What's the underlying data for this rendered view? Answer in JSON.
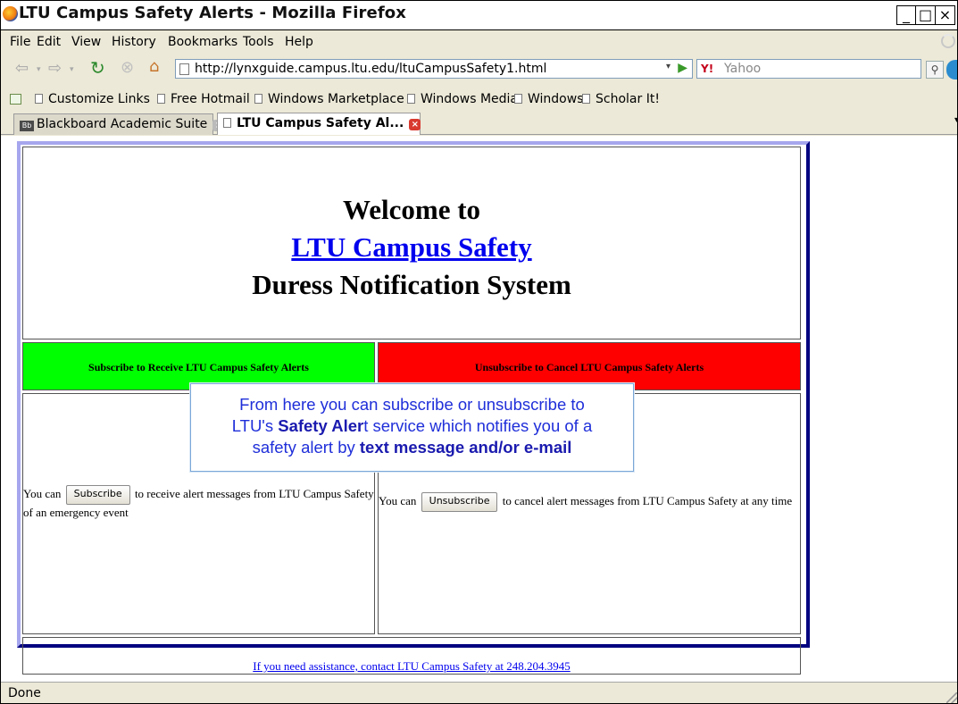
{
  "window": {
    "title": "LTU Campus Safety Alerts - Mozilla Firefox",
    "minimize_label": "_",
    "maximize_label": "□",
    "close_label": "×"
  },
  "menu": {
    "items": [
      "File",
      "Edit",
      "View",
      "History",
      "Bookmarks",
      "Tools",
      "Help"
    ]
  },
  "nav": {
    "url": "http://lynxguide.campus.ltu.edu/ltuCampusSafety1.html",
    "search_placeholder": "Yahoo",
    "search_engine": "Y!"
  },
  "bookmarks": {
    "items": [
      "Customize Links",
      "Free Hotmail",
      "Windows Marketplace",
      "Windows Media",
      "Windows",
      "Scholar It!"
    ]
  },
  "tabs": [
    {
      "label": "Blackboard Academic Suite",
      "icon": "Bb",
      "active": false
    },
    {
      "label": "LTU Campus Safety Al...",
      "active": true
    }
  ],
  "page": {
    "welcome": "Welcome to",
    "campus_link": "LTU Campus Safety",
    "system_name": "Duress Notification System",
    "subscribe_header": "Subscribe to Receive LTU Campus Safety Alerts",
    "unsubscribe_header": "Unsubscribe to Cancel LTU Campus Safety Alerts",
    "subscribe_prefix": "You can",
    "subscribe_button": "Subscribe",
    "subscribe_suffix": "to receive alert messages from LTU Campus Safety of an emergency event",
    "unsubscribe_prefix": "You can",
    "unsubscribe_button": "Unsubscribe",
    "unsubscribe_suffix": "to cancel alert messages from LTU Campus Safety at any time",
    "footer_link": "If you need assistance, contact LTU Campus Safety at 248.204.3945",
    "colors": {
      "subscribe_bg": "#00ff00",
      "unsubscribe_bg": "#ff0000",
      "link": "#0000ee"
    }
  },
  "callout": {
    "line1": "From here you can subscribe or unsubscribe to",
    "line2_prefix": "LTU's ",
    "line2_bold": "Safety Aler",
    "line2_suffix": "t service which notifies you of a",
    "line3_prefix": "safety alert by ",
    "line3_bold": "text message and/or e-mail"
  },
  "status": {
    "text": "Done"
  }
}
